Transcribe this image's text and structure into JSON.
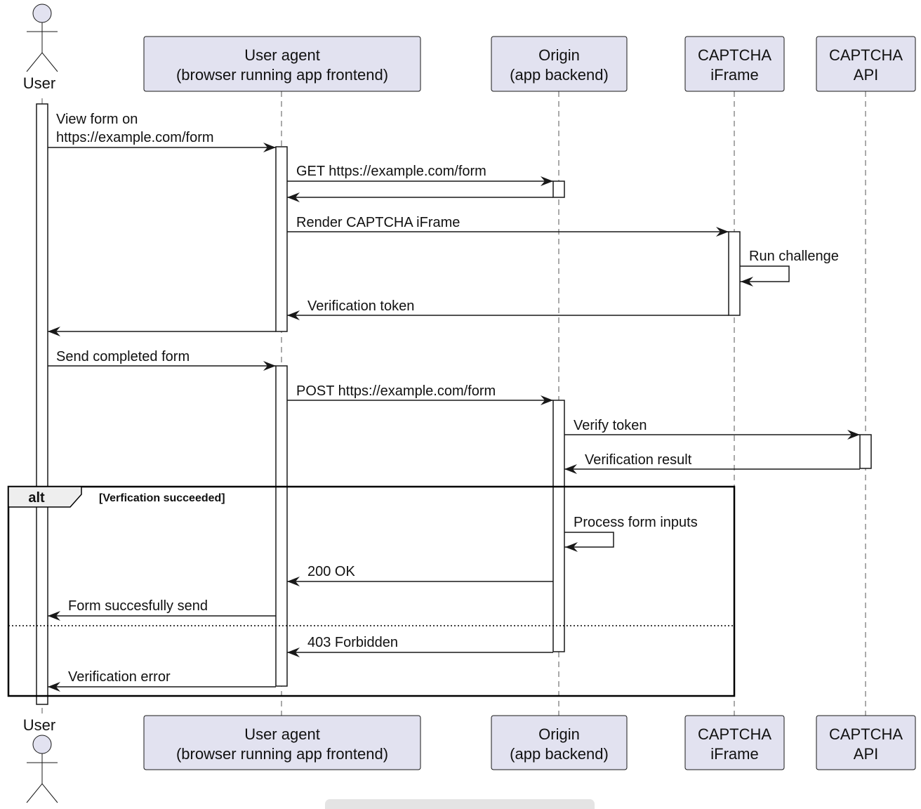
{
  "diagram": {
    "type": "sequence",
    "colors": {
      "participant_fill": "#e2e2f0",
      "participant_stroke": "#181818",
      "line": "#181818",
      "lifeline": "#555555",
      "alt_header_fill": "#eeeeee"
    },
    "participants": [
      {
        "id": "user",
        "kind": "actor",
        "label": "User"
      },
      {
        "id": "ua",
        "kind": "participant",
        "label_lines": [
          "User agent",
          "(browser running app frontend)"
        ]
      },
      {
        "id": "origin",
        "kind": "participant",
        "label_lines": [
          "Origin",
          "(app backend)"
        ]
      },
      {
        "id": "iframe",
        "kind": "participant",
        "label_lines": [
          "CAPTCHA",
          "iFrame"
        ]
      },
      {
        "id": "api",
        "kind": "participant",
        "label_lines": [
          "CAPTCHA",
          "API"
        ]
      }
    ],
    "messages": [
      {
        "from": "user",
        "to": "ua",
        "label_lines": [
          "View form on",
          " https://example.com/form"
        ]
      },
      {
        "from": "ua",
        "to": "origin",
        "label_lines": [
          "GET https://example.com/form"
        ]
      },
      {
        "from": "origin",
        "to": "ua",
        "label_lines": []
      },
      {
        "from": "ua",
        "to": "iframe",
        "label_lines": [
          "Render CAPTCHA iFrame"
        ]
      },
      {
        "from": "iframe",
        "to": "iframe",
        "label_lines": [
          "Run challenge"
        ]
      },
      {
        "from": "iframe",
        "to": "ua",
        "label_lines": [
          "Verification token"
        ]
      },
      {
        "from": "ua",
        "to": "user",
        "label_lines": []
      },
      {
        "from": "user",
        "to": "ua",
        "label_lines": [
          "Send completed form"
        ]
      },
      {
        "from": "ua",
        "to": "origin",
        "label_lines": [
          "POST https://example.com/form"
        ]
      },
      {
        "from": "origin",
        "to": "api",
        "label_lines": [
          "Verify token"
        ]
      },
      {
        "from": "api",
        "to": "origin",
        "label_lines": [
          "Verification result"
        ]
      },
      {
        "from": "origin",
        "to": "origin",
        "label_lines": [
          "Process form inputs"
        ]
      },
      {
        "from": "origin",
        "to": "ua",
        "label_lines": [
          "200 OK"
        ]
      },
      {
        "from": "ua",
        "to": "user",
        "label_lines": [
          "Form succesfully send"
        ]
      },
      {
        "from": "origin",
        "to": "ua",
        "label_lines": [
          "403 Forbidden"
        ]
      },
      {
        "from": "ua",
        "to": "user",
        "label_lines": [
          "Verification error"
        ]
      }
    ],
    "fragments": [
      {
        "kind": "alt",
        "label": "alt",
        "guard": "[Verfication succeeded]",
        "first_message": 11,
        "else_after_message": 13,
        "last_message": 15
      }
    ]
  }
}
